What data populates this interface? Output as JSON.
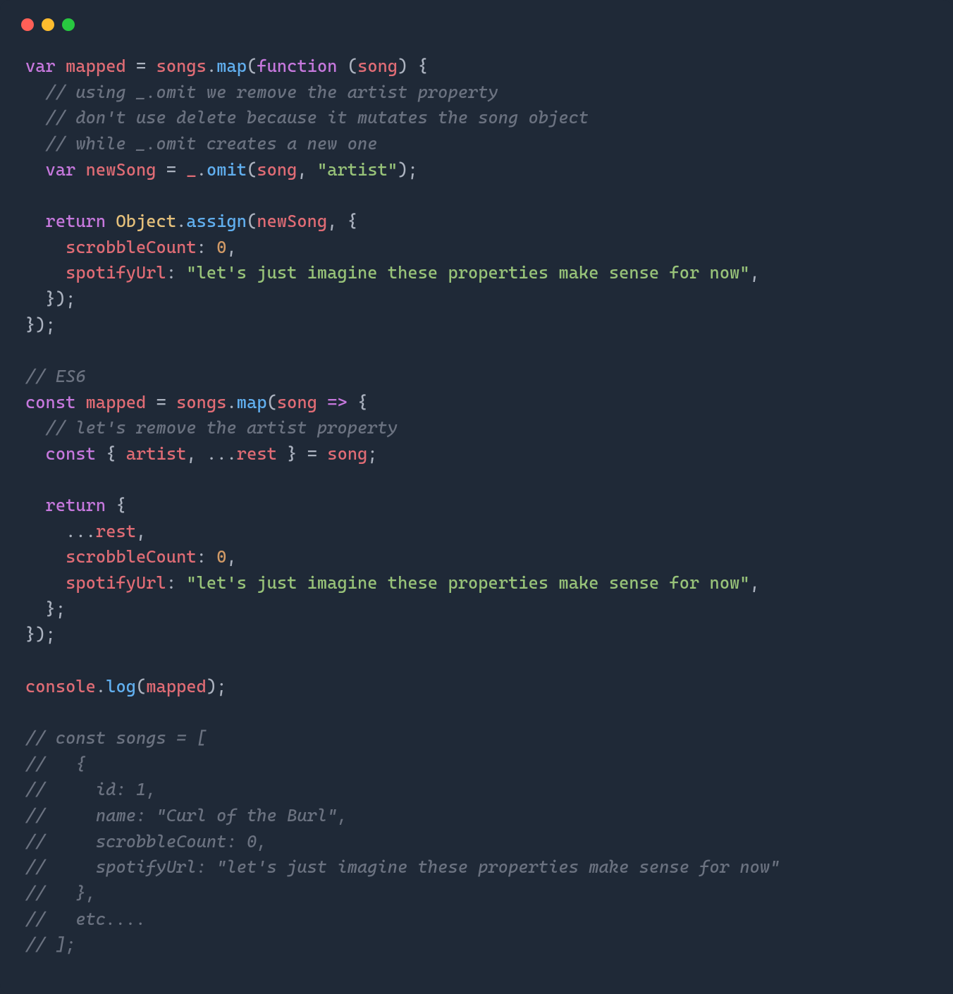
{
  "traffic": {
    "red": "#ff5f57",
    "yellow": "#febc2e",
    "green": "#28c840"
  },
  "tokens": {
    "var": "var",
    "const": "const",
    "return": "return",
    "function": "function",
    "mapped": "mapped",
    "songs": "songs",
    "map": "map",
    "song": "song",
    "newSong": "newSong",
    "underscore": "_",
    "omit": "omit",
    "artistStr": "\"artist\"",
    "Object": "Object",
    "assign": "assign",
    "scrobbleCount": "scrobbleCount",
    "spotifyUrl": "spotifyUrl",
    "zero": "0",
    "spotifyStr": "\"let's just imagine these properties make sense for now\"",
    "artist": "artist",
    "rest": "rest",
    "console": "console",
    "log": "log",
    "arrow": "=>"
  },
  "comments": {
    "c1": "// using _.omit we remove the artist property",
    "c2": "// don't use delete because it mutates the song object",
    "c3": "// while _.omit creates a new one",
    "es6": "// ES6",
    "c4": "// let's remove the artist property",
    "o1": "// const songs = [",
    "o2": "//   {",
    "o3": "//     id: 1,",
    "o4": "//     name: \"Curl of the Burl\",",
    "o5": "//     scrobbleCount: 0,",
    "o6": "//     spotifyUrl: \"let's just imagine these properties make sense for now\"",
    "o7": "//   },",
    "o8": "//   etc....",
    "o9": "// ];"
  }
}
